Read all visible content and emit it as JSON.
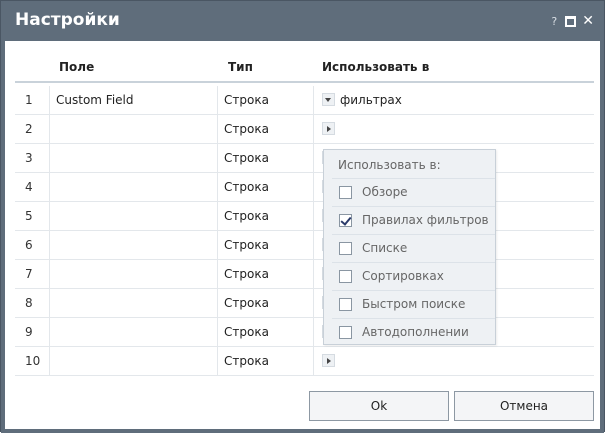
{
  "window": {
    "title": "Настройки",
    "help_label": "?",
    "close_label": "✕"
  },
  "table": {
    "columns": [
      "Поле",
      "Тип",
      "Использовать в"
    ],
    "rows": [
      {
        "num": "1",
        "field": "Custom Field",
        "type": "Строка",
        "use": "фильтрах"
      },
      {
        "num": "2",
        "field": "",
        "type": "Строка",
        "use": ""
      },
      {
        "num": "3",
        "field": "",
        "type": "Строка",
        "use": ""
      },
      {
        "num": "4",
        "field": "",
        "type": "Строка",
        "use": ""
      },
      {
        "num": "5",
        "field": "",
        "type": "Строка",
        "use": ""
      },
      {
        "num": "6",
        "field": "",
        "type": "Строка",
        "use": ""
      },
      {
        "num": "7",
        "field": "",
        "type": "Строка",
        "use": ""
      },
      {
        "num": "8",
        "field": "",
        "type": "Строка",
        "use": ""
      },
      {
        "num": "9",
        "field": "",
        "type": "Строка",
        "use": ""
      },
      {
        "num": "10",
        "field": "",
        "type": "Строка",
        "use": ""
      }
    ]
  },
  "dropdown": {
    "header": "Использовать в:",
    "options": [
      {
        "label": "Обзоре",
        "checked": false
      },
      {
        "label": "Правилах фильтров",
        "checked": true
      },
      {
        "label": "Списке",
        "checked": false
      },
      {
        "label": "Сортировках",
        "checked": false
      },
      {
        "label": "Быстром поиске",
        "checked": false
      },
      {
        "label": "Автодополнении",
        "checked": false
      }
    ]
  },
  "buttons": {
    "ok": "Ok",
    "cancel": "Отмена"
  },
  "colors": {
    "frame": "#5f6d7b",
    "grid_line": "#e3e7eb",
    "dropdown_bg": "#eef1f4"
  }
}
